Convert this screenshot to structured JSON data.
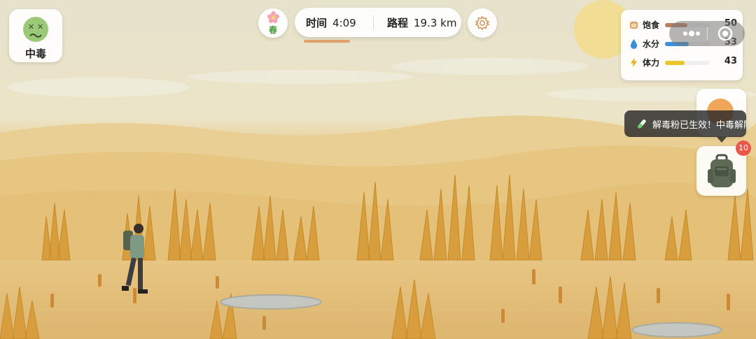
{
  "status": {
    "label": "中毒",
    "icon": "poisoned-face-icon"
  },
  "season": {
    "label": "春",
    "icon": "cherry-blossom-icon"
  },
  "hud": {
    "time_label": "时间",
    "time_value": "4:09",
    "distance_label": "路程",
    "distance_value": "19.3 km",
    "time_progress": 0.3
  },
  "stats": [
    {
      "name": "饱食",
      "value": "50",
      "level": 0.5,
      "color": "#b97f5e",
      "icon": "bread-icon"
    },
    {
      "name": "水分",
      "value": "53",
      "level": 0.53,
      "color": "#3a8fd8",
      "icon": "water-drop-icon"
    },
    {
      "name": "体力",
      "value": "43",
      "level": 0.43,
      "color": "#e8c627",
      "icon": "lightning-icon"
    }
  ],
  "toast": {
    "message": "解毒粉已生效！中毒解除",
    "icon": "test-tube-icon"
  },
  "backpack": {
    "badge": "10",
    "icon": "backpack-icon"
  },
  "colors": {
    "sand": "#e3bf7a",
    "grass": "#d9a03a",
    "sky": "#ece8d6"
  }
}
